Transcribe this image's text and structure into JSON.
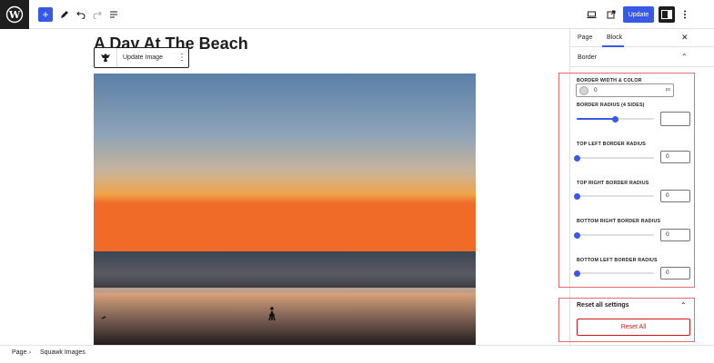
{
  "header": {
    "update_label": "Update"
  },
  "post": {
    "title": "A Day At The Beach",
    "block_toolbar_label": "Update Image"
  },
  "sidebar": {
    "tabs": [
      "Page",
      "Block"
    ],
    "panel_title": "Border",
    "border_width_label": "BORDER WIDTH & COLOR",
    "border_width_value": "0",
    "border_width_unit": "px",
    "radius_label": "BORDER RADIUS (4 SIDES)",
    "radius_value": "",
    "radius_fill": 0.5,
    "corners": [
      {
        "label": "TOP LEFT BORDER RADIUS",
        "value": "0"
      },
      {
        "label": "TOP RIGHT BORDER RADIUS",
        "value": "0"
      },
      {
        "label": "BOTTOM RIGHT BORDER RADIUS",
        "value": "0"
      },
      {
        "label": "BOTTOM LEFT BORDER RADIUS",
        "value": "0"
      }
    ],
    "reset_title": "Reset all settings",
    "reset_button": "Reset All"
  },
  "footer": {
    "breadcrumb": [
      "Page",
      "Squawk Images"
    ]
  },
  "colors": {
    "accent": "#3858e9",
    "danger": "#cc1818",
    "highlight": "#e46b6b"
  }
}
